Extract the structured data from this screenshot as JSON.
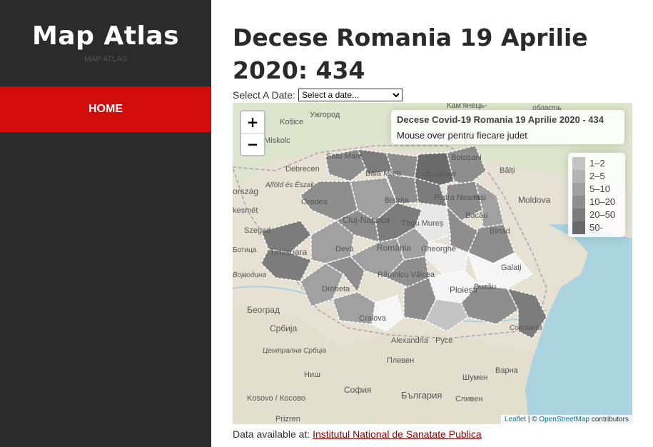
{
  "sidebar": {
    "brand_title": "Map Atlas",
    "brand_subtitle": "MAP ATLAS",
    "nav_home": "HOME",
    "nav_active_color": "#d10a0a"
  },
  "page": {
    "title": "Decese Romania 19 Aprilie 2020: 434",
    "date_label": "Select A Date:",
    "date_select_value": "Select a date...",
    "source_prefix": "Data available at:",
    "source_link": "Institutul National de Sanatate Publica"
  },
  "map": {
    "zoom_in": "+",
    "zoom_out": "−",
    "info_title": "Decese Covid-19 Romania 19 Aprilie 2020 - 434",
    "info_subtitle": "Mouse over pentru fiecare judet",
    "legend": [
      {
        "label": "1–2",
        "color": "#c4c4c4"
      },
      {
        "label": "2–5",
        "color": "#b2b2b2"
      },
      {
        "label": "5–10",
        "color": "#a0a0a0"
      },
      {
        "label": "10–20",
        "color": "#8e8e8e"
      },
      {
        "label": "20–50",
        "color": "#7c7c7c"
      },
      {
        "label": "50-",
        "color": "#6a6a6a"
      }
    ],
    "attribution_leaflet": "Leaflet",
    "attribution_sep": " | © ",
    "attribution_osm": "OpenStreetMap",
    "attribution_suffix": " contributors",
    "place_labels": {
      "uzhgorod": "Ужгород",
      "kamianets": "Кам'янець-",
      "oblast": "область",
      "kosice": "Košice",
      "miskolc": "Miskolc",
      "debrecen": "Debrecen",
      "satu_mare": "Satu Mare",
      "baia_mare": "Baia Mare",
      "suceava": "Suceava",
      "botosani": "Botoșani",
      "balti": "Bălți",
      "alfold": "Alföld és Észak",
      "orszag": "ország",
      "oradea": "Oradea",
      "cluj": "Cluj-Napoca",
      "bistrita": "Bistrița",
      "piatra": "Piatra Neamț",
      "iasi": "Iași",
      "moldova": "Moldova",
      "kesmet": "kesmét",
      "szeged": "Szeged",
      "tirgu_mures": "Tîrgu Mureș",
      "bacau": "Bacău",
      "birlad": "Bîrlad",
      "botica": "Ботица",
      "timisoara": "Timișoara",
      "deva": "Deva",
      "romania": "România",
      "sf_gheorghe": "Gheorghe",
      "galati": "Galați",
      "vojvodina": "Војводина",
      "ramnicu": "Râmnicu Vâlcea",
      "ploiesti": "Ploiești",
      "buzau": "Buzău",
      "drobeta": "Drobeta",
      "beograd": "Београд",
      "srbija": "Србија",
      "craiova": "Craiova",
      "constanta": "Constanța",
      "alexandria": "Alexandria",
      "ruse": "Русе",
      "centralna": "Централна Србија",
      "pleven": "Плевен",
      "nis": "Ниш",
      "shumen": "Шумен",
      "varna": "Варна",
      "sofia": "София",
      "bulgaria": "България",
      "sliven": "Сливен",
      "kosovo": "Kosovo / Косово",
      "prizren": "Prizren"
    }
  }
}
